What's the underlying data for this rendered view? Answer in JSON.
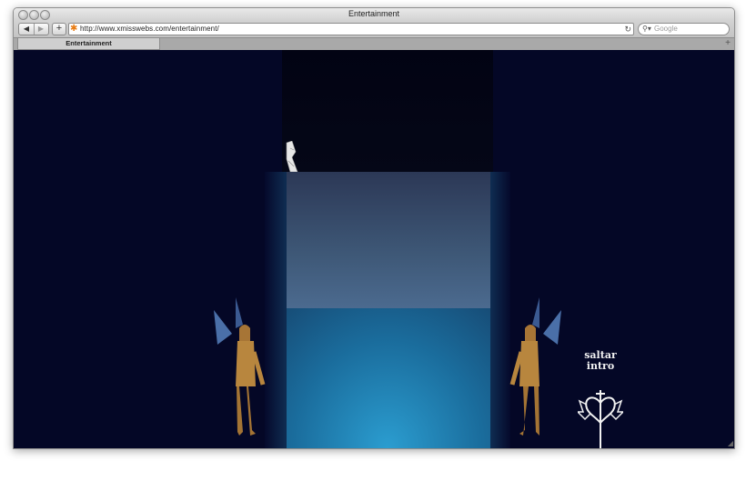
{
  "window": {
    "title": "Entertainment"
  },
  "toolbar": {
    "back_icon": "back-arrow-icon",
    "forward_icon": "forward-arrow-icon",
    "add_label": "+",
    "url": "http://www.xmisswebs.com/entertainment/",
    "search_placeholder": "Google"
  },
  "tabs": [
    {
      "label": "Entertainment"
    }
  ],
  "page": {
    "skip_intro_line1": "saltar",
    "skip_intro_line2": "intro"
  },
  "colors": {
    "background": "#040726",
    "screen_top": "#2c3856",
    "curtain_glow": "#2b9dd0",
    "angel_robe": "#b8863e",
    "angel_wings": "#4a6fa8"
  }
}
